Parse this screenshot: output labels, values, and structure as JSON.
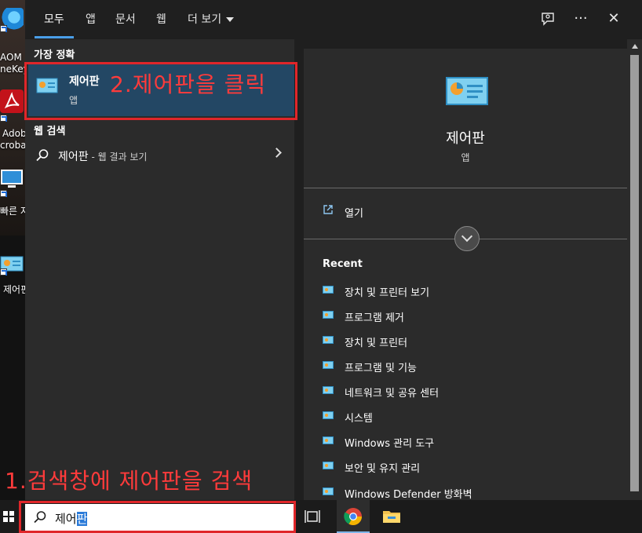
{
  "desktop": {
    "icons": [
      {
        "label": "AOM",
        "label2": "neKey"
      },
      {
        "label": "Adob",
        "label2": "crobat"
      },
      {
        "label": "빠른 지"
      },
      {
        "label": "제어핀"
      }
    ]
  },
  "tabs": [
    {
      "label": "모두",
      "active": true
    },
    {
      "label": "앱"
    },
    {
      "label": "문서"
    },
    {
      "label": "웹"
    },
    {
      "label": "더 보기"
    }
  ],
  "toolbar": {
    "feedback_icon": "feedback-icon",
    "more_label": "···",
    "close_label": "✕"
  },
  "results": {
    "best_match_header": "가장 정확",
    "best_match": {
      "title": "제어판",
      "subtitle": "앱"
    },
    "web_header": "웹 검색",
    "web_item": {
      "query": "제어판",
      "hint": " - 웹 결과 보기"
    }
  },
  "preview": {
    "title": "제어판",
    "subtitle": "앱",
    "open_label": "열기",
    "recent_header": "Recent",
    "recent_items": [
      "장치 및 프린터 보기",
      "프로그램 제거",
      "장치 및 프린터",
      "프로그램 및 기능",
      "네트워크 및 공유 센터",
      "시스템",
      "Windows 관리 도구",
      "보안 및 유지 관리",
      "Windows Defender 방화벽"
    ]
  },
  "annotations": {
    "step2": "2.제어판을 클릭",
    "step1": "1.검색창에 제어판을 검색"
  },
  "taskbar": {
    "search_value_plain": "제어",
    "search_value_selected": "판"
  },
  "colors": {
    "accent": "#4a9ee8",
    "best_match_bg": "#234764",
    "annotation_red": "#e0262a"
  }
}
